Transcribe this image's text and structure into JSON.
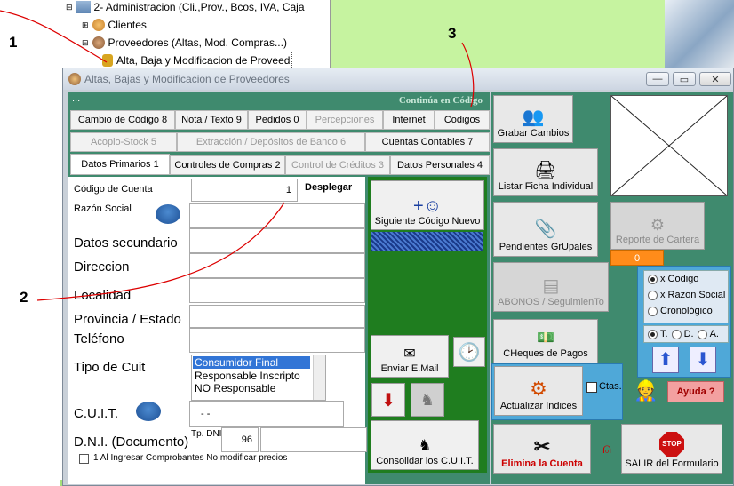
{
  "tree": {
    "items": [
      "2- Administracion (Cli.,Prov., Bcos, IVA, Caja",
      "Clientes",
      "Proveedores (Altas, Mod. Compras...)",
      "Alta, Baja y Modificacion  de Proveed"
    ]
  },
  "annotations": {
    "n1": "1",
    "n2": "2",
    "n3": "3"
  },
  "window": {
    "title": "Altas, Bajas y Modificacion de Proveedores",
    "minimize": "—",
    "maximize": "▭",
    "close": "✕"
  },
  "strip": {
    "dots": "...",
    "continua": "Continúa en Código"
  },
  "tabs": {
    "row1": [
      "Cambio de Código 8",
      "Nota / Texto 9",
      "Pedidos 0",
      "Percepciones",
      "Internet",
      "Codigos"
    ],
    "row2": [
      "Acopio-Stock 5",
      "Extracción / Depósitos de Banco 6",
      "Cuentas Contables 7"
    ],
    "row3": [
      "Datos Primarios 1",
      "Controles de Compras 2",
      "Control de Créditos 3",
      "Datos Personales 4"
    ]
  },
  "form": {
    "codigo_label": "Código de Cuenta",
    "codigo_value": "1",
    "desplegar": "Desplegar",
    "razon_label": "Razón Social",
    "secundario_label": "Datos secundario",
    "direccion_label": "Direccion",
    "localidad_label": "Localidad",
    "provincia_label": "Provincia / Estado",
    "telefono_label": "Teléfono",
    "tipo_cuit_label": "Tipo de Cuit",
    "tipo_cuit_options": [
      "Consumidor Final",
      "Responsable Inscripto",
      "NO Responsable"
    ],
    "cuit_label": "C.U.I.T.",
    "cuit_value": "-      -",
    "dni_label": "D.N.I. (Documento)",
    "tp_dni_label": "Tp. DNI",
    "tp_dni_value": "96",
    "check_label": "1 Al Ingresar Comprobantes No modificar precios"
  },
  "green": {
    "siguiente": "Siguiente Código Nuevo",
    "email": "Enviar E.Mail",
    "consolidar": "Consolidar los C.U.I.T."
  },
  "right": {
    "grabar": "Grabar Cambios",
    "listar": "Listar Ficha Individual",
    "pendientes": "Pendientes GrUpales",
    "reporte": "Reporte de Cartera",
    "reporte_count": "0",
    "abonos": "ABONOS / SeguimienTo",
    "cheques": "CHeques de Pagos",
    "actualizar": "Actualizar Indices",
    "ctas": "Ctas.",
    "ayuda": "Ayuda ?",
    "elimina": "Elimina la Cuenta",
    "salir": "SALIR del Formulario",
    "order": [
      "x Codigo",
      "x Razon Social",
      "Cronológico"
    ],
    "filter": [
      "T.",
      "D.",
      "A."
    ]
  },
  "colors": {
    "window_green": "#3f8a6e",
    "form_green": "#1f7d1f",
    "orange": "#ff8c1a",
    "red": "#cc0000"
  }
}
